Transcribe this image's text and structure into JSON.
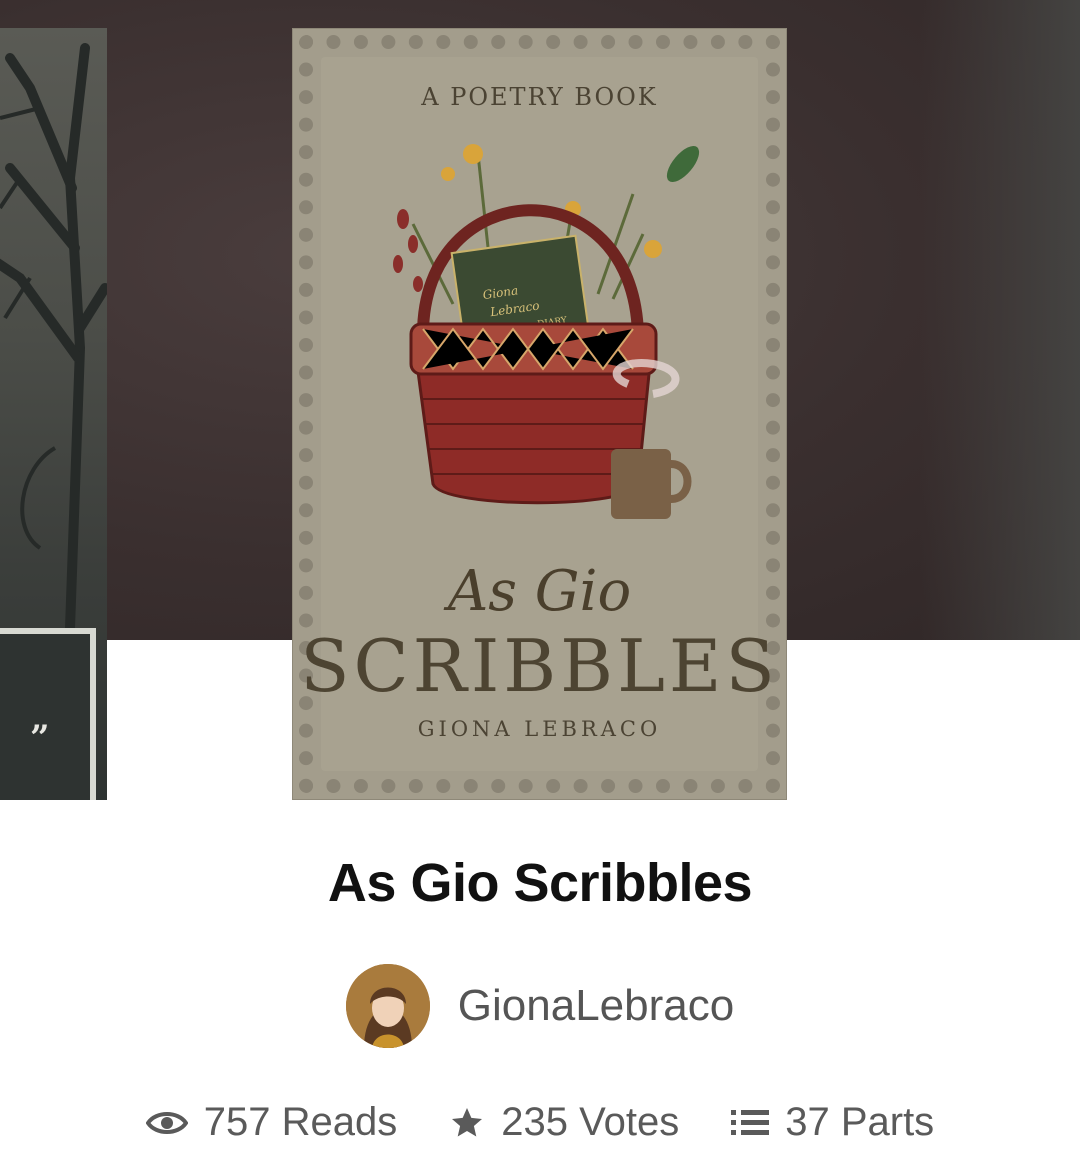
{
  "cover": {
    "kicker": "A POETRY BOOK",
    "script_title": "As Gio",
    "main_title": "SCRIBBLES",
    "author": "GIONA LEBRACO",
    "book_label": "Giona Lebraco DIARY"
  },
  "side_cover": {
    "visible_text": "”"
  },
  "story": {
    "title": "As Gio Scribbles",
    "author": "GionaLebraco"
  },
  "stats": {
    "reads": "757 Reads",
    "votes": "235 Votes",
    "parts": "37 Parts"
  },
  "icons": [
    "eye-icon",
    "star-icon",
    "list-icon"
  ],
  "colors": {
    "hero_bg": "#3a2f2f",
    "cover_bg": "#a8a290",
    "title_text": "#111111",
    "meta_text": "#5a5a5a"
  }
}
